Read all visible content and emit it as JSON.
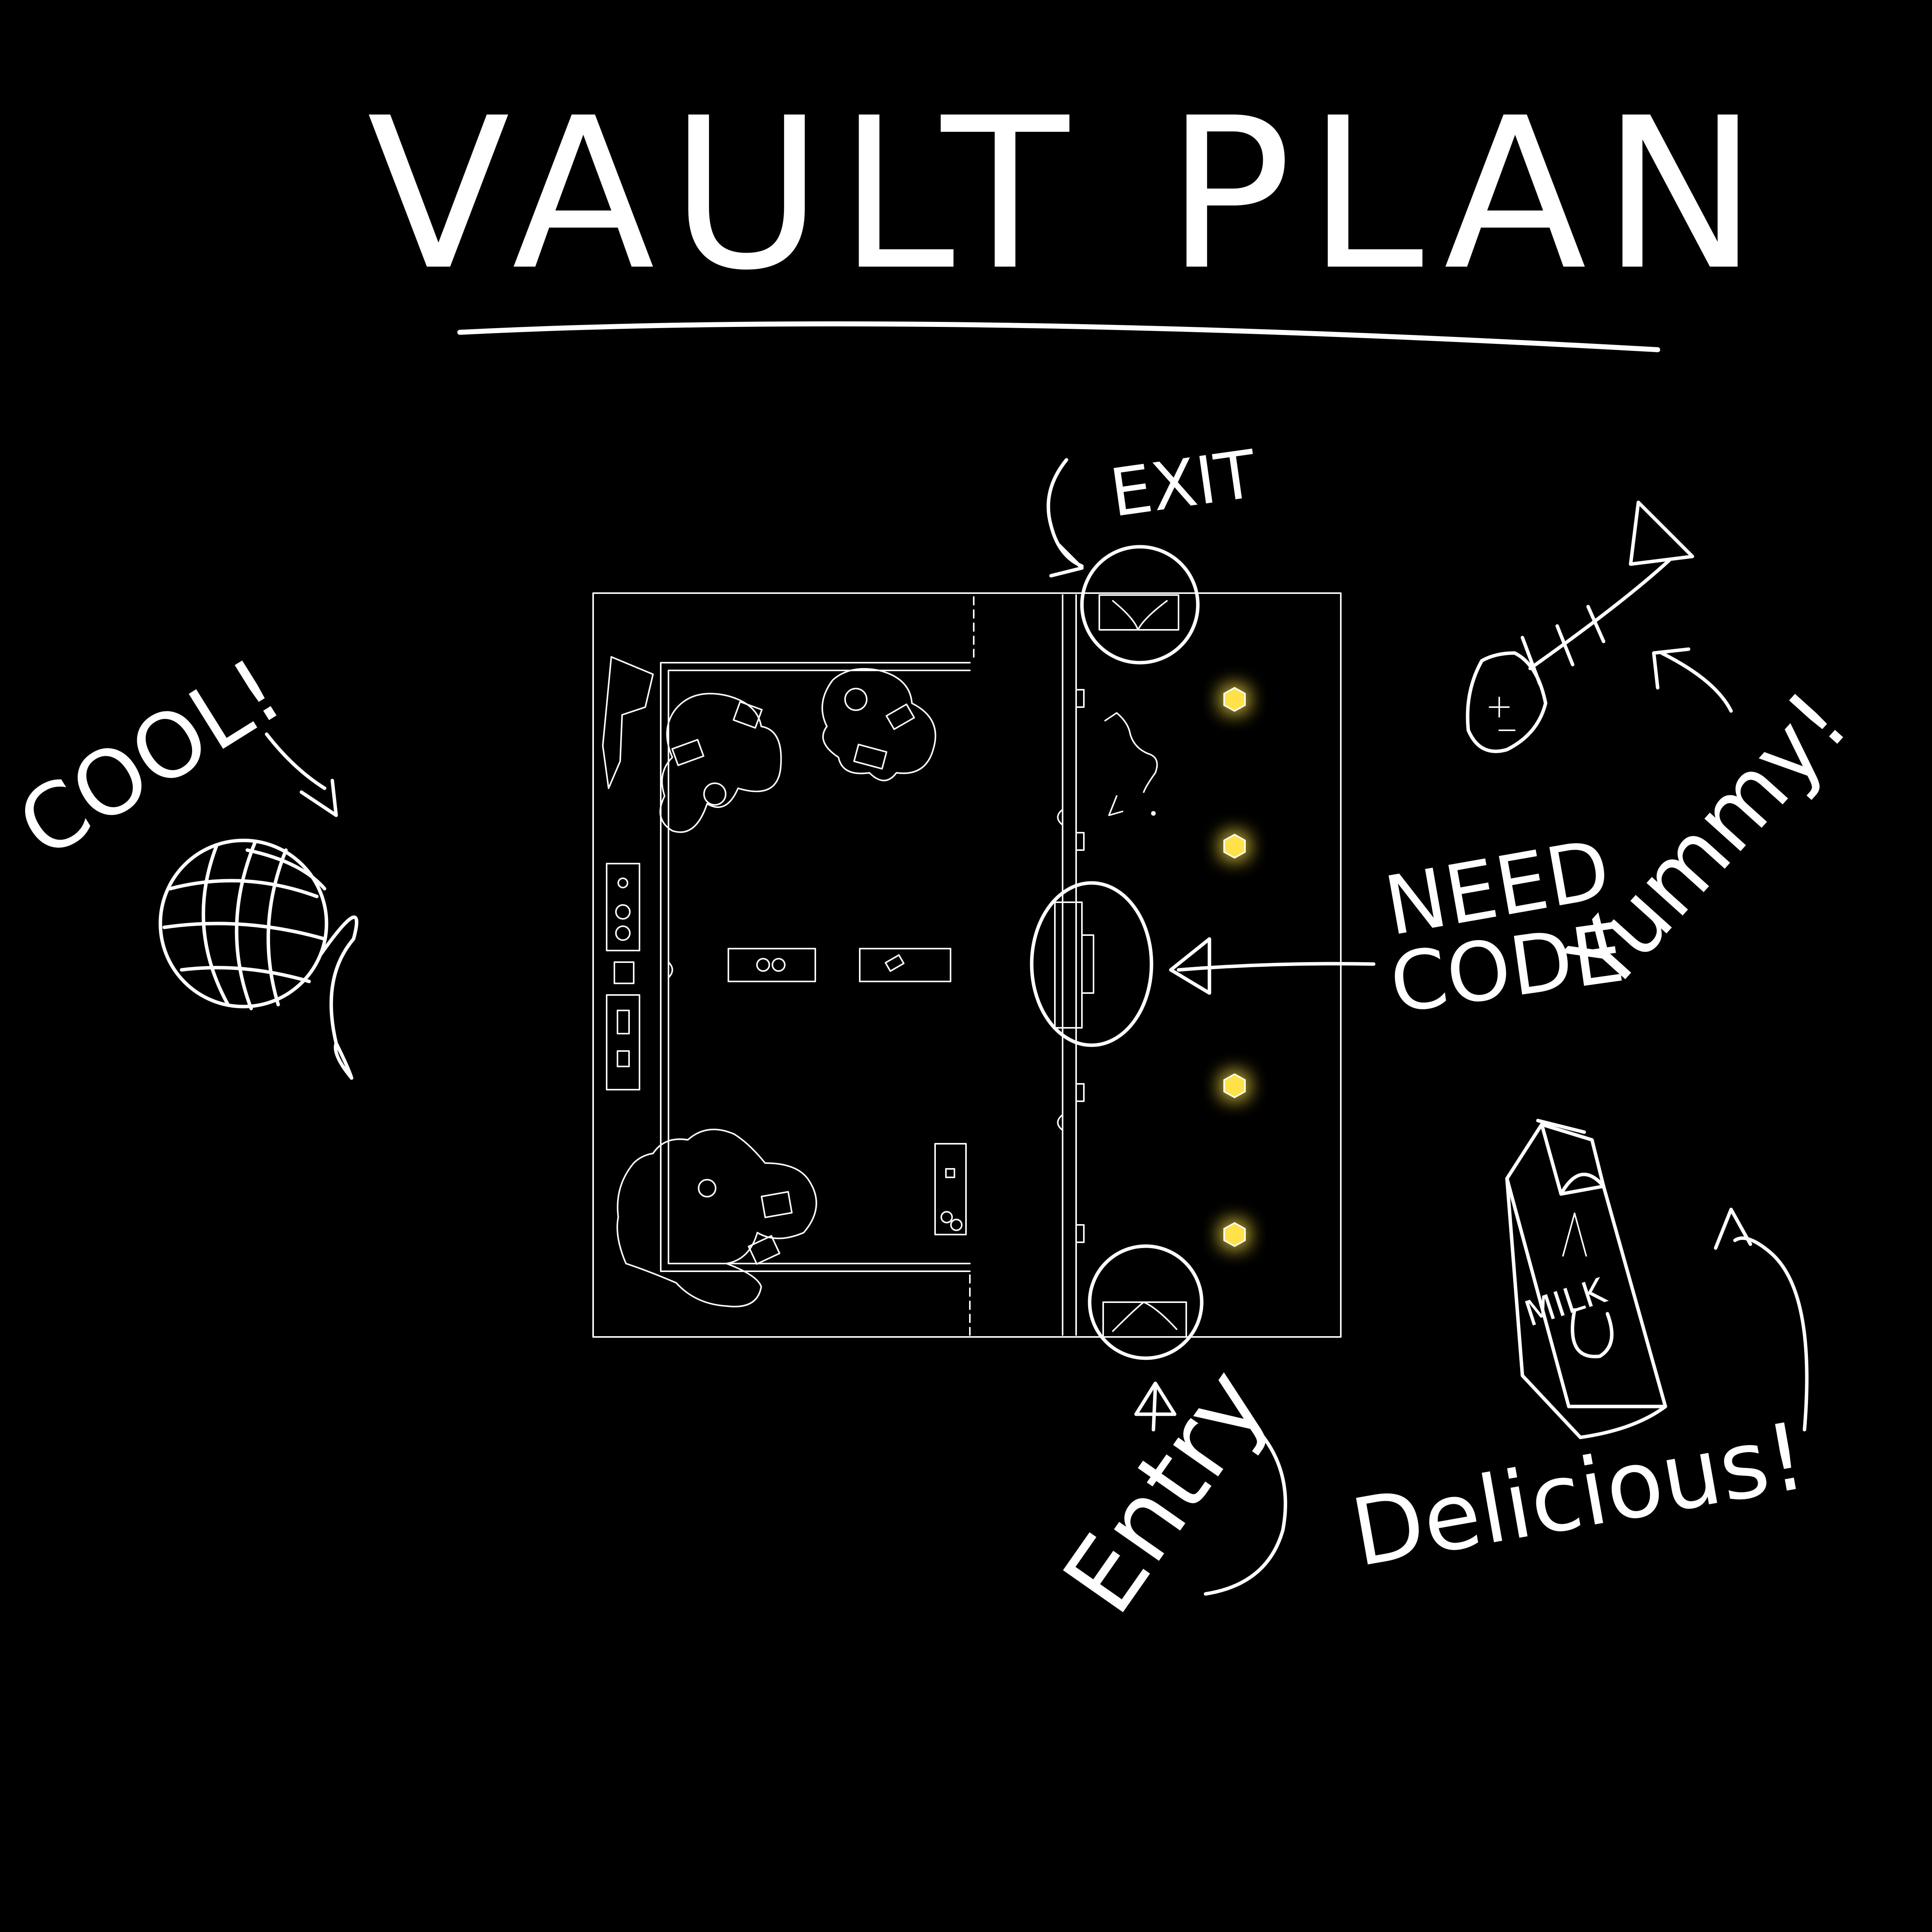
{
  "title": "VAULT PLAN",
  "labels": {
    "exit": "EXIT",
    "entry": "Entry",
    "need_code": "NEED\nCODE",
    "need_code_line1": "NEED",
    "need_code_line2": "CODE",
    "cool": "COOL!",
    "yummy": "Yummy!",
    "delicious": "Delicious!",
    "milk": "MILK"
  },
  "colors": {
    "background": "#000000",
    "ink": "#ffffff",
    "light": "#ffe14a"
  },
  "icons": {
    "yarn": "yarn-ball-icon",
    "fish": "fish-bone-icon",
    "milk": "milk-carton-icon"
  }
}
